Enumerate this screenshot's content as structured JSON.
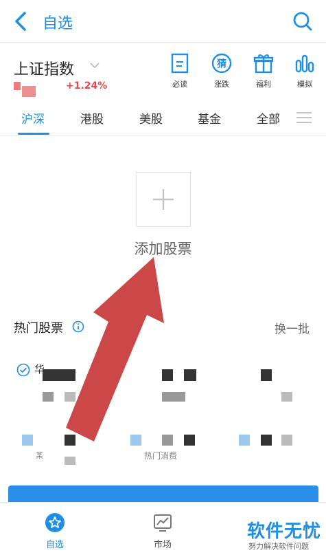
{
  "header": {
    "title": "自选"
  },
  "index": {
    "name": "上证指数",
    "change": "+1.24%"
  },
  "quick_links": [
    {
      "label": "必读",
      "icon": "document-icon"
    },
    {
      "label": "涨跌",
      "icon": "guess-icon",
      "badge": "猜"
    },
    {
      "label": "福利",
      "icon": "gift-icon"
    },
    {
      "label": "模拟",
      "icon": "bar-chart-icon"
    }
  ],
  "tabs": [
    "沪深",
    "港股",
    "美股",
    "基金",
    "全部"
  ],
  "add": {
    "label": "添加股票"
  },
  "hot": {
    "title": "热门股票",
    "refresh": "换一批",
    "row_fragment": "华"
  },
  "list_fragments": [
    "某",
    "热门消费"
  ],
  "nav": [
    {
      "label": "自选",
      "icon": "star-icon"
    },
    {
      "label": "市场",
      "icon": "market-chart-icon"
    }
  ],
  "watermark": {
    "main": "软件无忧",
    "sub": "努力解决软件问题"
  },
  "colors": {
    "accent": "#1e8ee6",
    "up": "#e84a4a",
    "arrow": "#c83a3a"
  }
}
